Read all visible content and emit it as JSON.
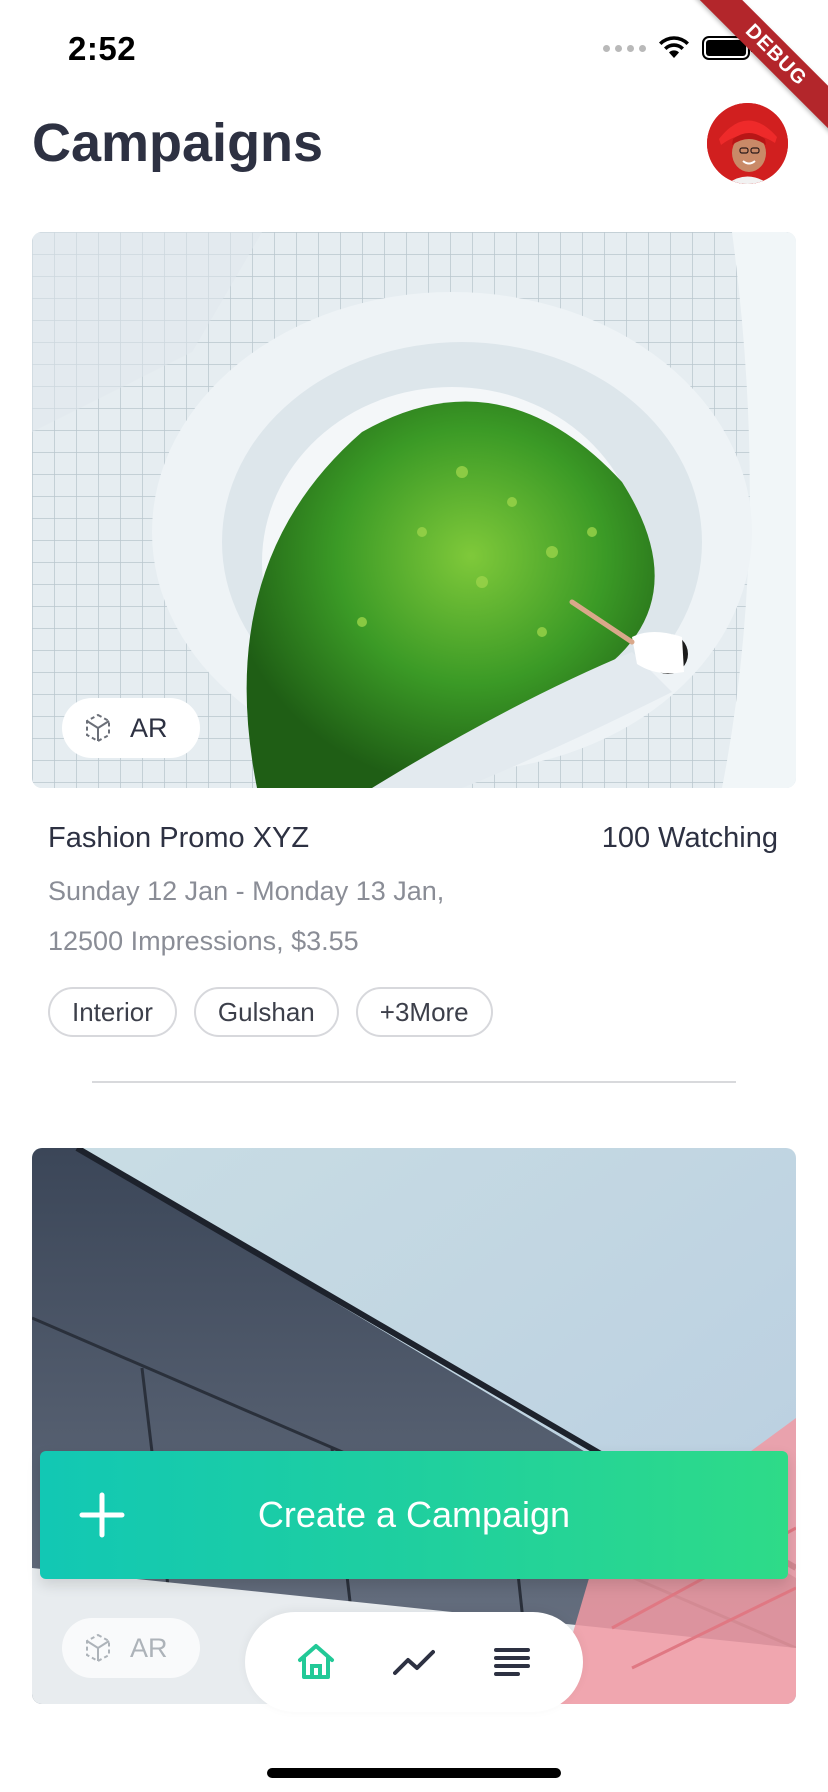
{
  "status_bar": {
    "time": "2:52"
  },
  "debug_ribbon": "DEBUG",
  "header": {
    "title": "Campaigns"
  },
  "colors": {
    "accent_start": "#12c8b4",
    "accent_end": "#2edb88",
    "title": "#2d3142",
    "muted": "#8a8d96"
  },
  "campaigns": [
    {
      "ar_label": "AR",
      "title": "Fashion Promo XYZ",
      "watching": "100 Watching",
      "dates": "Sunday 12 Jan - Monday 13 Jan,",
      "stats": "12500 Impressions, $3.55",
      "tags": [
        "Interior",
        "Gulshan",
        "+3More"
      ]
    },
    {
      "ar_label": "AR"
    }
  ],
  "create_button": {
    "label": "Create a Campaign",
    "icon": "plus-icon"
  },
  "bottom_nav": [
    {
      "icon": "home-icon",
      "active": true
    },
    {
      "icon": "trend-icon",
      "active": false
    },
    {
      "icon": "list-icon",
      "active": false
    }
  ]
}
